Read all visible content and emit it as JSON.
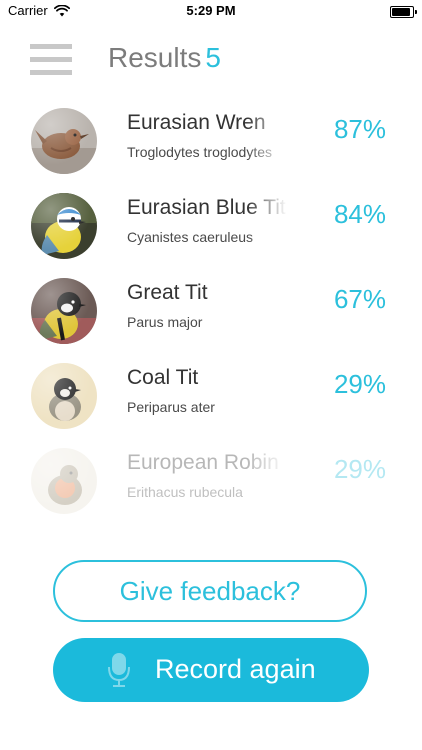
{
  "status_bar": {
    "carrier": "Carrier",
    "time": "5:29 PM",
    "battery_level": 1.0
  },
  "header": {
    "menu_icon": "hamburger-icon",
    "title": "Results",
    "count": "5"
  },
  "results": [
    {
      "common_name": "Eurasian Wren",
      "latin_name": "Troglodytes troglodytes",
      "confidence": "87%"
    },
    {
      "common_name": "Eurasian Blue Tit",
      "latin_name": "Cyanistes caeruleus",
      "confidence": "84%"
    },
    {
      "common_name": "Great Tit",
      "latin_name": "Parus major",
      "confidence": "67%"
    },
    {
      "common_name": "Coal Tit",
      "latin_name": "Periparus ater",
      "confidence": "29%"
    },
    {
      "common_name": "European Robin",
      "latin_name": "Erithacus rubecula",
      "confidence": "29%"
    }
  ],
  "actions": {
    "feedback_label": "Give feedback?",
    "record_label": "Record again",
    "record_icon": "microphone-icon"
  },
  "colors": {
    "accent": "#2cc0dc",
    "record_button": "#1bbadb",
    "menu_icon": "#c8c8c8"
  }
}
